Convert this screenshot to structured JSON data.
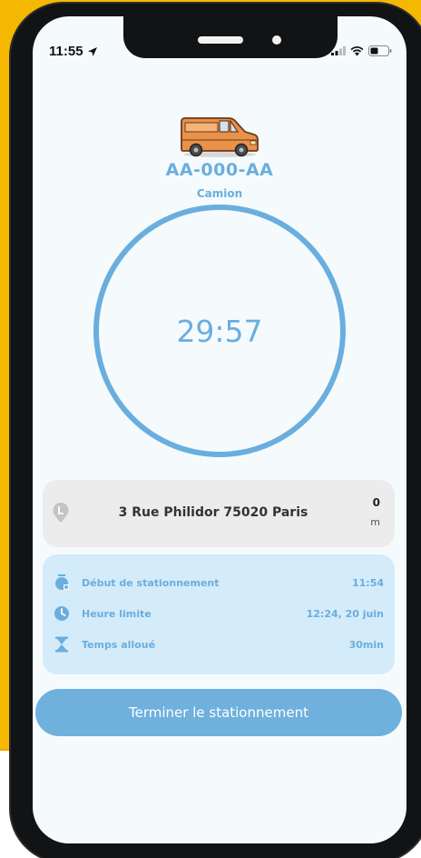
{
  "status_bar": {
    "time": "11:55"
  },
  "vehicle": {
    "plate": "AA-000-AA",
    "type": "Camion"
  },
  "timer": {
    "display": "29:57"
  },
  "address_card": {
    "address": "3 Rue Philidor 75020 Paris",
    "distance_value": "0",
    "distance_unit": "m"
  },
  "info_card": {
    "rows": [
      {
        "label": "Début de stationnement",
        "value": "11:54",
        "icon": "stopwatch-icon"
      },
      {
        "label": "Heure limite",
        "value": "12:24, 20 juin",
        "icon": "clock-icon"
      },
      {
        "label": "Temps alloué",
        "value": "30min",
        "icon": "hourglass-icon"
      }
    ]
  },
  "actions": {
    "end_parking_label": "Terminer le stationnement"
  },
  "colors": {
    "accent": "#6aaede",
    "button": "#6fb0dd",
    "info_bg": "#d4ebf9",
    "address_bg": "#ececec",
    "background": "#f5b800"
  }
}
